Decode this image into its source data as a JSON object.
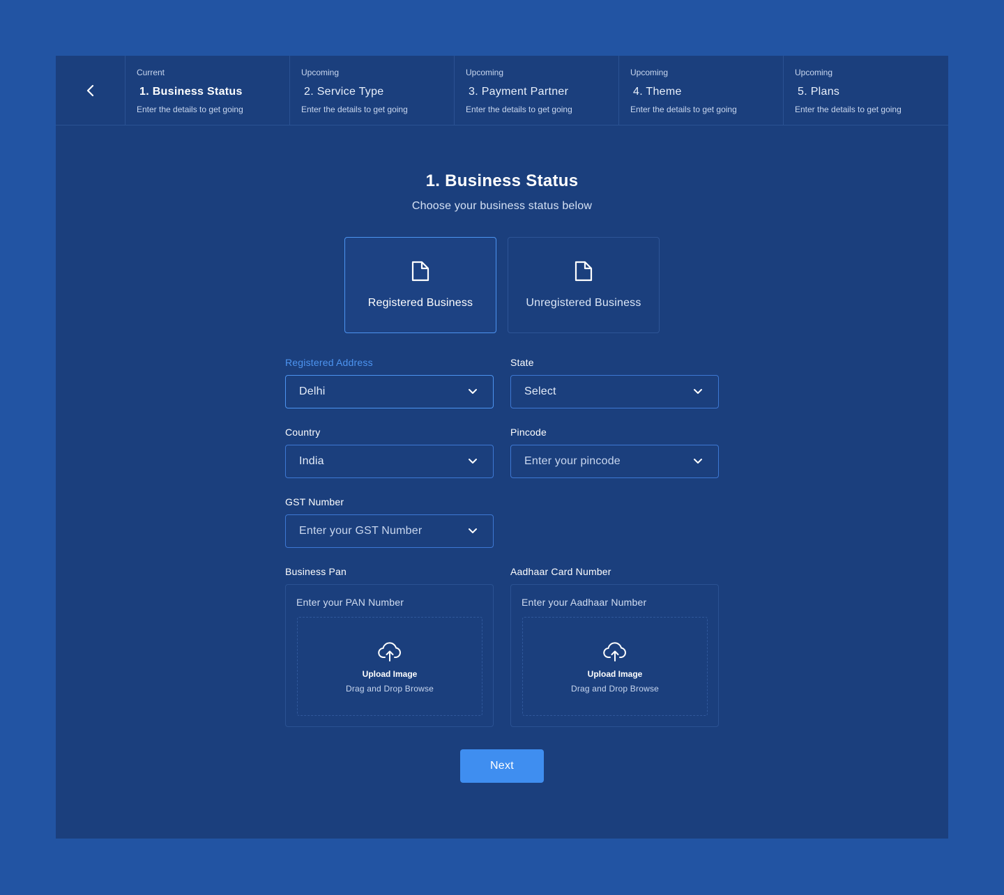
{
  "stepper": {
    "steps": [
      {
        "status": "Current",
        "name": "1. Business Status",
        "desc": "Enter the details to get going"
      },
      {
        "status": "Upcoming",
        "name": "2. Service Type",
        "desc": "Enter the details to get going"
      },
      {
        "status": "Upcoming",
        "name": "3. Payment Partner",
        "desc": "Enter the details to get going"
      },
      {
        "status": "Upcoming",
        "name": "4. Theme",
        "desc": "Enter the details to get going"
      },
      {
        "status": "Upcoming",
        "name": "5. Plans",
        "desc": "Enter the details to get going"
      }
    ]
  },
  "main": {
    "title": "1. Business Status",
    "subtitle": "Choose your business status below",
    "options": [
      {
        "label": "Registered Business",
        "icon": "document-icon",
        "selected": true
      },
      {
        "label": "Unregistered Business",
        "icon": "document-icon",
        "selected": false
      }
    ]
  },
  "form": {
    "registered_address": {
      "label": "Registered Address",
      "value": "Delhi"
    },
    "state": {
      "label": "State",
      "value": "Select"
    },
    "country": {
      "label": "Country",
      "value": "India"
    },
    "pincode": {
      "label": "Pincode",
      "placeholder": "Enter your pincode"
    },
    "gst": {
      "label": "GST Number",
      "placeholder": "Enter your GST Number"
    },
    "pan": {
      "label": "Business Pan",
      "placeholder": "Enter your PAN Number",
      "upload_title": "Upload Image",
      "upload_sub": "Drag and Drop Browse"
    },
    "aadhaar": {
      "label": "Aadhaar Card Number",
      "placeholder": "Enter your Aadhaar Number",
      "upload_title": "Upload Image",
      "upload_sub": "Drag and Drop Browse"
    }
  },
  "actions": {
    "next_label": "Next"
  },
  "colors": {
    "page_bg": "#2254a3",
    "card_bg": "#1b3f7d",
    "accent": "#4d94f0",
    "button": "#3f8ef0"
  }
}
